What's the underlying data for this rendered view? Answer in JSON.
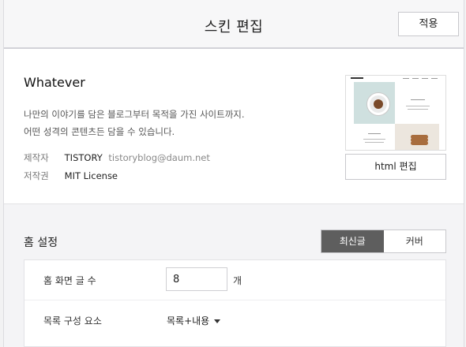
{
  "header": {
    "title": "스킨 편집",
    "apply_label": "적용"
  },
  "skin": {
    "name": "Whatever",
    "description_lines": [
      "나만의 이야기를 담은 블로그부터 목적을 가진 사이트까지.",
      "어떤 성격의 콘텐츠든 담을 수 있습니다."
    ],
    "author_label": "제작자",
    "author_name": "TISTORY",
    "author_email": "tistoryblog@daum.net",
    "license_label": "저작권",
    "license_value": "MIT License",
    "html_edit_label": "html 편집"
  },
  "home": {
    "title": "홈 설정",
    "tabs": [
      {
        "label": "최신글",
        "active": true
      },
      {
        "label": "커버",
        "active": false
      }
    ],
    "post_count_label": "홈 화면 글 수",
    "post_count_value": "8",
    "post_count_unit": "개",
    "list_element_label": "목록 구성 요소",
    "list_element_value": "목록+내용"
  },
  "colors": {
    "active_tab_bg": "#5e5e5e",
    "page_bg": "#f2f2f3"
  }
}
